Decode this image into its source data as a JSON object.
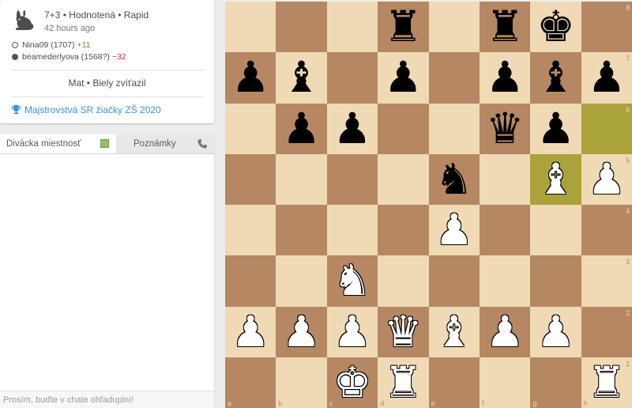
{
  "game": {
    "title": "7+3 • Hodnotená • Rapid",
    "time_ago": "42 hours ago",
    "white_player": {
      "name": "Nina09 (1707)",
      "diff": "+11"
    },
    "black_player": {
      "name": "beamederlyova (1568?)",
      "diff": "−32"
    },
    "result": "Mat • Biely zvíťazil",
    "tournament": "Majstrovstvá SR žiačky ZŠ 2020",
    "icons": {
      "speed": "rabbit-icon",
      "tournament": "trophy-icon"
    }
  },
  "chat": {
    "tab_chat": "Divácka miestnosť",
    "tab_notes": "Poznámky",
    "input_placeholder": "Prosím, buďte v chate ohľaduplní!",
    "icons": {
      "toggle": "chat-toggle-checkbox",
      "notes": "phone-icon"
    }
  },
  "board": {
    "colors": {
      "light": "#f0d9b5",
      "dark": "#b58863",
      "highlight": "#aaa23a"
    },
    "files": [
      "a",
      "b",
      "c",
      "d",
      "e",
      "f",
      "g",
      "h"
    ],
    "ranks": [
      "8",
      "7",
      "6",
      "5",
      "4",
      "3",
      "2",
      "1"
    ],
    "highlighted_squares": [
      "h6",
      "g5"
    ],
    "pieces": [
      {
        "square": "d8",
        "color": "b",
        "type": "R"
      },
      {
        "square": "f8",
        "color": "b",
        "type": "R"
      },
      {
        "square": "g8",
        "color": "b",
        "type": "K"
      },
      {
        "square": "a7",
        "color": "b",
        "type": "P"
      },
      {
        "square": "b7",
        "color": "b",
        "type": "B"
      },
      {
        "square": "d7",
        "color": "b",
        "type": "P"
      },
      {
        "square": "f7",
        "color": "b",
        "type": "P"
      },
      {
        "square": "g7",
        "color": "b",
        "type": "B"
      },
      {
        "square": "h7",
        "color": "b",
        "type": "P"
      },
      {
        "square": "b6",
        "color": "b",
        "type": "P"
      },
      {
        "square": "c6",
        "color": "b",
        "type": "P"
      },
      {
        "square": "f6",
        "color": "b",
        "type": "Q"
      },
      {
        "square": "g6",
        "color": "b",
        "type": "P"
      },
      {
        "square": "e5",
        "color": "b",
        "type": "N"
      },
      {
        "square": "g5",
        "color": "w",
        "type": "B"
      },
      {
        "square": "h5",
        "color": "w",
        "type": "P"
      },
      {
        "square": "e4",
        "color": "w",
        "type": "P"
      },
      {
        "square": "c3",
        "color": "w",
        "type": "N"
      },
      {
        "square": "a2",
        "color": "w",
        "type": "P"
      },
      {
        "square": "b2",
        "color": "w",
        "type": "P"
      },
      {
        "square": "c2",
        "color": "w",
        "type": "P"
      },
      {
        "square": "d2",
        "color": "w",
        "type": "Q"
      },
      {
        "square": "e2",
        "color": "w",
        "type": "B"
      },
      {
        "square": "f2",
        "color": "w",
        "type": "P"
      },
      {
        "square": "g2",
        "color": "w",
        "type": "P"
      },
      {
        "square": "c1",
        "color": "w",
        "type": "K"
      },
      {
        "square": "d1",
        "color": "w",
        "type": "R"
      },
      {
        "square": "h1",
        "color": "w",
        "type": "R"
      }
    ]
  }
}
